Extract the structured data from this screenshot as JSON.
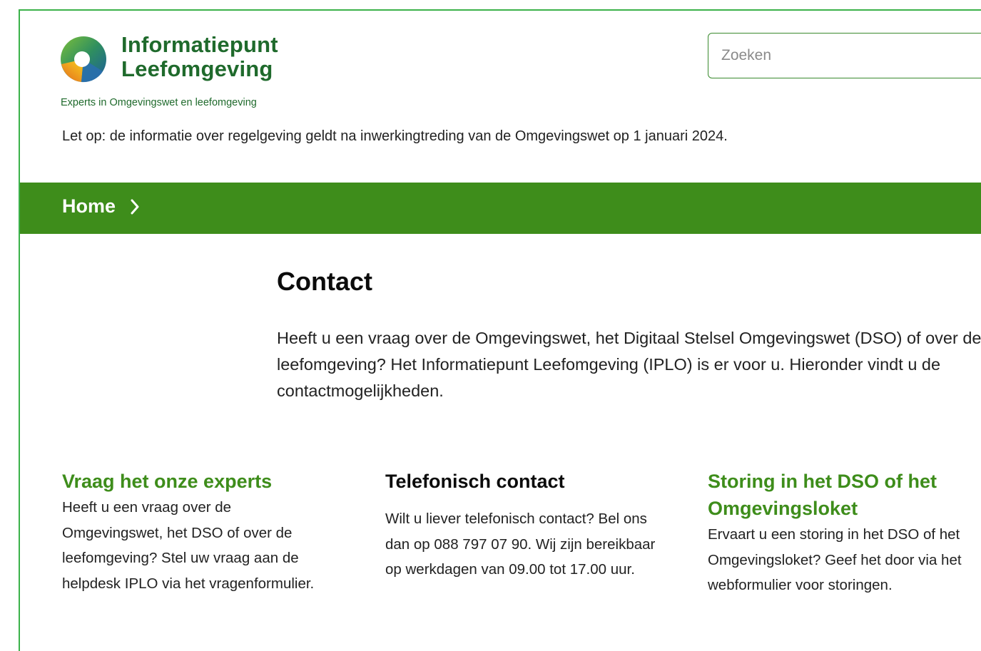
{
  "header": {
    "logo_line1": "Informatiepunt",
    "logo_line2": "Leefomgeving",
    "tagline": "Experts in Omgevingswet en leefomgeving",
    "search_placeholder": "Zoeken",
    "notice": "Let op: de informatie over regelgeving geldt na inwerkingtreding van de Omgevingswet op 1 januari 2024."
  },
  "nav": {
    "breadcrumb_home": "Home",
    "bar_color": "#3e8d1b"
  },
  "main": {
    "title": "Contact",
    "intro": "Heeft u een vraag over de Omgevingswet, het Digitaal Stelsel Omgevingswet (DSO) of over de leefomgeving? Het Informatiepunt Leefomgeving (IPLO) is er voor u. Hieronder vindt u de contactmogelijkheden."
  },
  "columns": [
    {
      "heading": "Vraag het onze experts",
      "text": "Heeft u een vraag over de Omgevingswet, het DSO of over de leefomgeving? Stel uw vraag aan de helpdesk IPLO via het vragenformulier."
    },
    {
      "heading": "Telefonisch contact",
      "text": "Wilt u liever telefonisch contact? Bel ons dan op 088 797 07 90. Wij zijn bereikbaar op werkdagen van 09.00 tot 17.00 uur."
    },
    {
      "heading": "Storing in het DSO of het Omgevingsloket",
      "text": "Ervaart u een storing in het DSO of het Omgevingsloket? Geef het door via het webformulier voor storingen."
    }
  ],
  "colors": {
    "brand_green": "#1f6a2c",
    "accent_green": "#3e8d1b",
    "frame_border": "#3bb24a"
  },
  "icons": {
    "logo": "iplo-ring-logo-icon",
    "breadcrumb_separator": "chevron-right-icon"
  }
}
